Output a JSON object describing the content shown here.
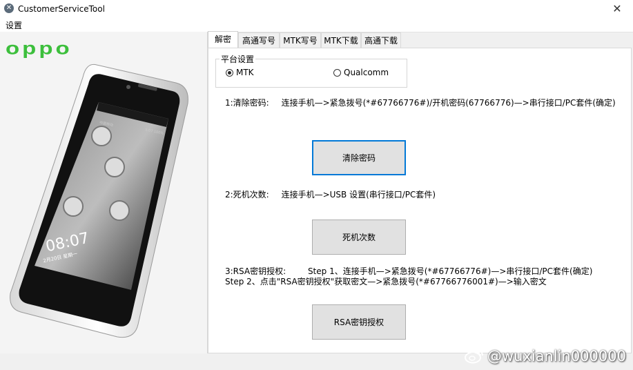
{
  "window": {
    "title": "CustomerServiceTool",
    "close_glyph": "✕"
  },
  "menu": {
    "settings": "设置"
  },
  "brand": {
    "logo_text": "oppo",
    "phone_screen": {
      "time": "08:07",
      "date": "2月20日 星期一",
      "carrier": "中国移动",
      "status": "5:07 100%"
    }
  },
  "tabs": [
    {
      "label": "解密",
      "active": true
    },
    {
      "label": "高通写号",
      "active": false
    },
    {
      "label": "MTK写号",
      "active": false
    },
    {
      "label": "MTK下载",
      "active": false
    },
    {
      "label": "高通下载",
      "active": false
    }
  ],
  "platform": {
    "legend": "平台设置",
    "options": [
      {
        "label": "MTK",
        "checked": true
      },
      {
        "label": "Qualcomm",
        "checked": false
      }
    ]
  },
  "sections": {
    "clear_password": {
      "label": "1:清除密码:",
      "instruction": "连接手机—>紧急拨号(*#67766776#)/开机密码(67766776)—>串行接口/PC套件(确定)",
      "button": "清除密码"
    },
    "death_count": {
      "label": "2:死机次数:",
      "instruction": "连接手机—>USB 设置(串行接口/PC套件)",
      "button": "死机次数"
    },
    "rsa": {
      "label": "3:RSA密钥授权:",
      "step1": "Step 1、连接手机—>紧急拨号(*#67766776#)—>串行接口/PC套件(确定)",
      "step2": "Step 2、点击\"RSA密钥授权\"获取密文—>紧急拨号(*#67766776001#)—>输入密文",
      "button": "RSA密钥授权"
    }
  },
  "watermark": "@wuxianlin000000",
  "colors": {
    "accent": "#0078d7",
    "logo": "#3cbf3c"
  }
}
